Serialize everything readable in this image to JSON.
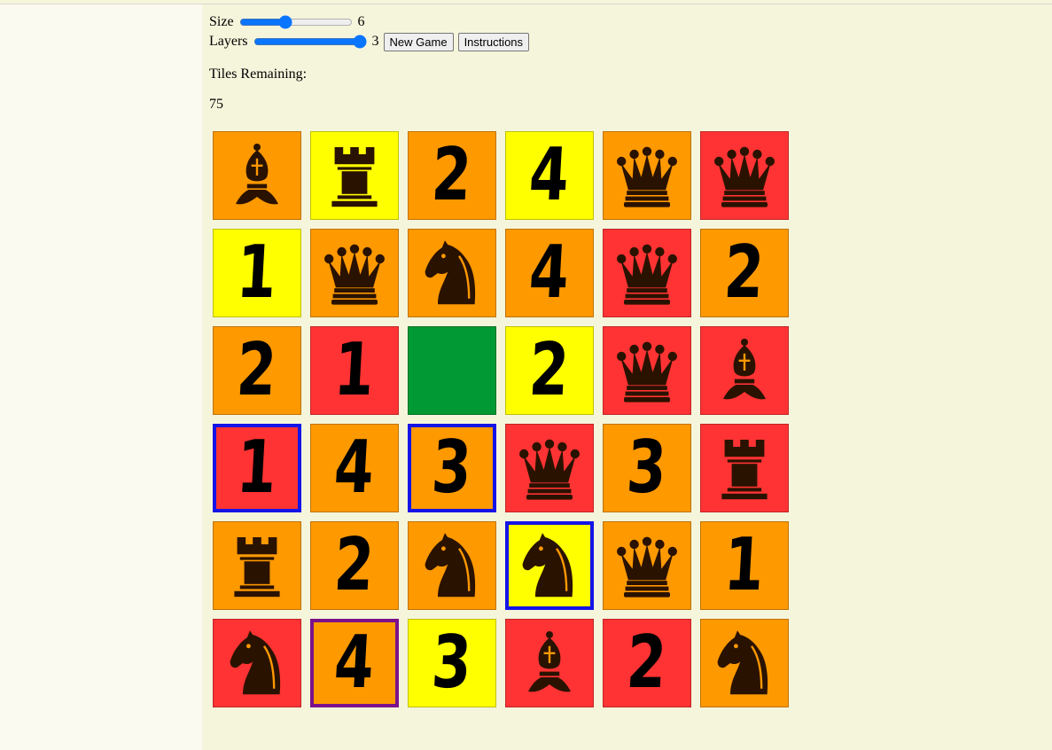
{
  "controls": {
    "size_label": "Size",
    "size_value": "6",
    "size_min": "2",
    "size_max": "12",
    "layers_label": "Layers",
    "layers_value": "3",
    "layers_min": "1",
    "layers_max": "3",
    "new_game_label": "New Game",
    "instructions_label": "Instructions"
  },
  "status": {
    "tiles_remaining_label": "Tiles Remaining:",
    "tiles_remaining_value": "75"
  },
  "colors": {
    "orange": "#ff9900",
    "yellow": "#ffff00",
    "red": "#ff3333",
    "green": "#009933",
    "selected_blue": "#1414e6",
    "selected_purple": "#7b128a"
  },
  "board": [
    {
      "color": "orange",
      "kind": "bishop"
    },
    {
      "color": "yellow",
      "kind": "rook"
    },
    {
      "color": "orange",
      "kind": "number",
      "label": "2"
    },
    {
      "color": "yellow",
      "kind": "number",
      "label": "4"
    },
    {
      "color": "orange",
      "kind": "queen"
    },
    {
      "color": "red",
      "kind": "queen"
    },
    {
      "color": "yellow",
      "kind": "number",
      "label": "1"
    },
    {
      "color": "orange",
      "kind": "queen"
    },
    {
      "color": "orange",
      "kind": "knight"
    },
    {
      "color": "orange",
      "kind": "number",
      "label": "4"
    },
    {
      "color": "red",
      "kind": "queen"
    },
    {
      "color": "orange",
      "kind": "number",
      "label": "2"
    },
    {
      "color": "orange",
      "kind": "number",
      "label": "2"
    },
    {
      "color": "red",
      "kind": "number",
      "label": "1"
    },
    {
      "color": "green",
      "kind": "empty"
    },
    {
      "color": "yellow",
      "kind": "number",
      "label": "2"
    },
    {
      "color": "red",
      "kind": "queen"
    },
    {
      "color": "red",
      "kind": "bishop"
    },
    {
      "color": "red",
      "kind": "number",
      "label": "1",
      "selected": "blue"
    },
    {
      "color": "orange",
      "kind": "number",
      "label": "4"
    },
    {
      "color": "orange",
      "kind": "number",
      "label": "3",
      "selected": "blue"
    },
    {
      "color": "red",
      "kind": "queen"
    },
    {
      "color": "orange",
      "kind": "number",
      "label": "3"
    },
    {
      "color": "red",
      "kind": "rook"
    },
    {
      "color": "orange",
      "kind": "rook"
    },
    {
      "color": "orange",
      "kind": "number",
      "label": "2"
    },
    {
      "color": "orange",
      "kind": "knight"
    },
    {
      "color": "yellow",
      "kind": "knight",
      "selected": "blue"
    },
    {
      "color": "orange",
      "kind": "queen"
    },
    {
      "color": "orange",
      "kind": "number",
      "label": "1"
    },
    {
      "color": "red",
      "kind": "knight"
    },
    {
      "color": "orange",
      "kind": "number",
      "label": "4",
      "selected": "purple"
    },
    {
      "color": "yellow",
      "kind": "number",
      "label": "3"
    },
    {
      "color": "red",
      "kind": "bishop"
    },
    {
      "color": "red",
      "kind": "number",
      "label": "2"
    },
    {
      "color": "orange",
      "kind": "knight"
    }
  ]
}
